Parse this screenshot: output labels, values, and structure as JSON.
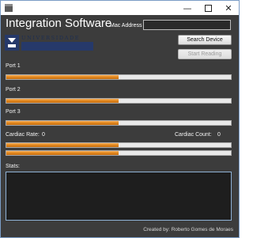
{
  "window": {
    "app_icon": "app-icon",
    "minimize_icon": "minimize-icon",
    "maximize_icon": "maximize-icon",
    "close_icon": "close-icon"
  },
  "header": {
    "title": "Integration Software",
    "mac_label": "Mac Address",
    "mac_value": ""
  },
  "logo": {
    "text": "UNIVERSIDADE",
    "icon": "university-logo-icon"
  },
  "buttons": {
    "search": "Search Device",
    "start": "Start Reading"
  },
  "ports": [
    {
      "label": "Port 1",
      "progress": 0.5
    },
    {
      "label": "Port 2",
      "progress": 0.5
    },
    {
      "label": "Port 3",
      "progress": 0.5
    }
  ],
  "cardiac": {
    "rate_label": "Cardiac Rate:",
    "rate_value": "0",
    "count_label": "Cardiac Count:",
    "count_value": "0",
    "bars": [
      0.5,
      0.5
    ]
  },
  "stats": {
    "label": "Stats:",
    "text": ""
  },
  "footer": {
    "credit": "Created by: Roberto Gomes de Moraes"
  },
  "colors": {
    "background": "#3c3c3c",
    "progress_fill": "#e58a1f",
    "progress_track": "#e9e9e9",
    "stats_border": "#8fb2d6"
  }
}
